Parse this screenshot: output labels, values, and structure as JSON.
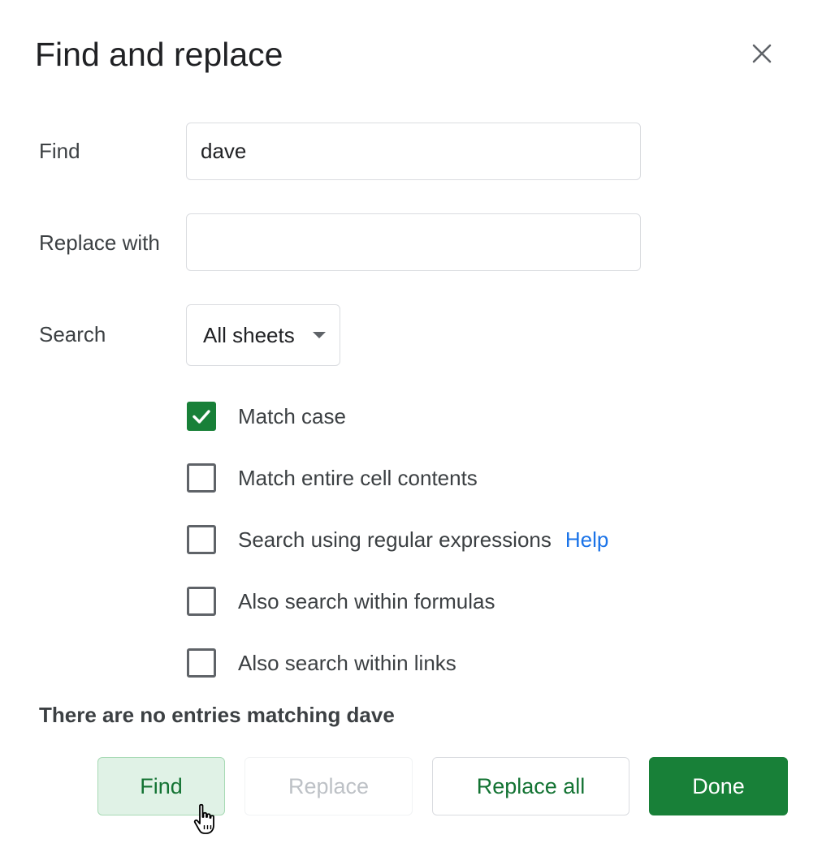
{
  "dialog": {
    "title": "Find and replace",
    "close_icon": "close-icon"
  },
  "find": {
    "label": "Find",
    "value": "dave"
  },
  "replace_with": {
    "label": "Replace with",
    "value": ""
  },
  "search": {
    "label": "Search",
    "selected": "All sheets"
  },
  "options": {
    "match_case": {
      "label": "Match case",
      "checked": true
    },
    "match_entire": {
      "label": "Match entire cell contents",
      "checked": false
    },
    "regex": {
      "label": "Search using regular expressions",
      "checked": false,
      "help_label": "Help"
    },
    "formulas": {
      "label": "Also search within formulas",
      "checked": false
    },
    "links": {
      "label": "Also search within links",
      "checked": false
    }
  },
  "status": "There are no entries matching dave",
  "buttons": {
    "find": "Find",
    "replace": "Replace",
    "replace_all": "Replace all",
    "done": "Done"
  },
  "colors": {
    "accent_green": "#188038",
    "link_blue": "#1a73e8",
    "disabled_text": "#bdc1c6"
  },
  "cursor_icon": "hand-pointer-icon"
}
